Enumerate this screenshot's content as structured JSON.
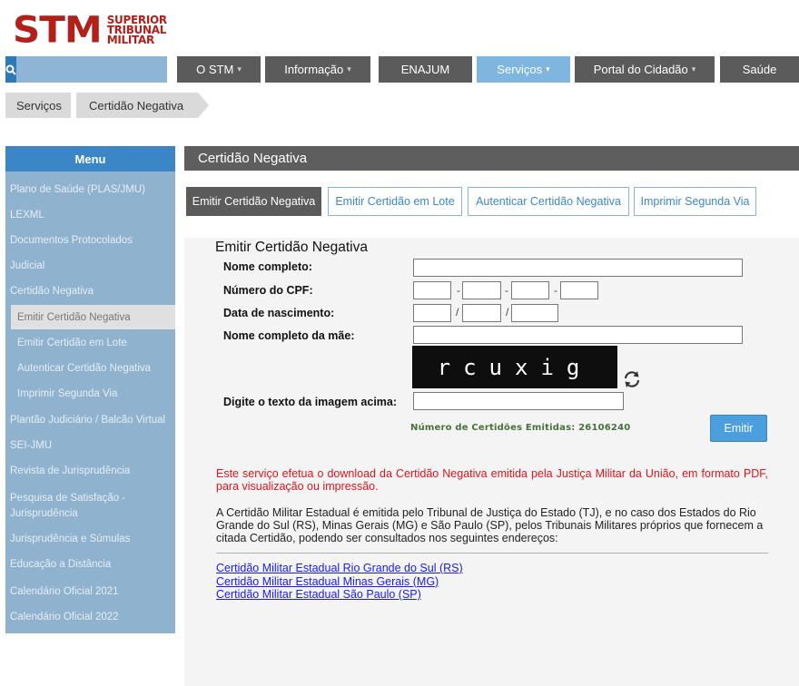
{
  "logo": {
    "main": "STM",
    "line1": "SUPERIOR",
    "line2": "TRIBUNAL",
    "line3": "MILITAR"
  },
  "search": {
    "placeholder": "",
    "icon": "search-icon"
  },
  "nav": [
    {
      "label": "O STM",
      "caret": true,
      "active": false
    },
    {
      "label": "Informação",
      "caret": true,
      "active": false
    },
    {
      "label": "ENAJUM",
      "caret": false,
      "active": false
    },
    {
      "label": "Serviços",
      "caret": true,
      "active": true
    },
    {
      "label": "Portal do Cidadão",
      "caret": true,
      "active": false
    },
    {
      "label": "Saúde",
      "caret": false,
      "active": false
    }
  ],
  "breadcrumb": [
    "Serviços",
    "Certidão Negativa"
  ],
  "sidebar": {
    "title": "Menu",
    "items": [
      {
        "label": "Plano de Saúde (PLAS/JMU)",
        "level": 0
      },
      {
        "label": "LEXML",
        "level": 0
      },
      {
        "label": "Documentos Protocolados",
        "level": 0
      },
      {
        "label": "Judicial",
        "level": 0
      },
      {
        "label": "Certidão Negativa",
        "level": 0
      },
      {
        "label": "Emitir Certidão Negativa",
        "level": 1,
        "selected": true
      },
      {
        "label": "Emitir Certidão em Lote",
        "level": 1
      },
      {
        "label": "Autenticar Certidão Negativa",
        "level": 1
      },
      {
        "label": "Imprimir Segunda Via",
        "level": 1
      },
      {
        "label": "Plantão Judiciário / Balcão Virtual",
        "level": 0
      },
      {
        "label": "SEI-JMU",
        "level": 0
      },
      {
        "label": "Revista de Jurisprudência",
        "level": 0
      },
      {
        "label": "Pesquisa de Satisfação - Jurisprudência",
        "level": 0
      },
      {
        "label": "Jurisprudência e Súmulas",
        "level": 0
      },
      {
        "label": "Educação a Distância",
        "level": 0
      },
      {
        "label": "Calendário Oficial 2021",
        "level": 0
      },
      {
        "label": "Calendário Oficial 2022",
        "level": 0
      }
    ]
  },
  "main": {
    "title": "Certidão Negativa",
    "tabs": [
      {
        "label": "Emitir Certidão Negativa",
        "active": true
      },
      {
        "label": "Emitir Certidão em Lote",
        "active": false
      },
      {
        "label": "Autenticar Certidão Negativa",
        "active": false
      },
      {
        "label": "Imprimir Segunda Via",
        "active": false
      }
    ]
  },
  "form": {
    "title": "Emitir Certidão Negativa",
    "name_label": "Nome completo:",
    "name_value": "",
    "cpf_label": "Número do CPF:",
    "cpf_values": [
      "",
      "",
      "",
      ""
    ],
    "cpf_separators": [
      "-",
      "-",
      "-"
    ],
    "dob_label": "Data de nascimento:",
    "dob_values": [
      "",
      "",
      ""
    ],
    "dob_separators": [
      "/",
      "/"
    ],
    "mother_label": "Nome completo da mãe:",
    "mother_value": "",
    "captcha_text": "rcuxig",
    "captcha_label": "Digite o texto da imagem acima:",
    "captcha_value": "",
    "refresh_icon": "refresh-icon",
    "count_text": "Número de Certidões Emitidas: 26106240",
    "count_value": 26106240,
    "submit_label": "Emitir"
  },
  "notes": {
    "warning": "Este serviço efetua o download da Certidão Negativa emitida pela Justiça Militar da União, em formato PDF, para visualização ou impressão.",
    "info": "A Certidão Militar Estadual é emitida pelo Tribunal de Justiça do Estado (TJ), e no caso dos Estados do Rio Grande do Sul (RS), Minas Gerais (MG) e São Paulo (SP), pelos Tribunais Militares próprios que fornecem a citada Certidão, podendo ser consultados nos seguintes endereços:",
    "links": [
      "Certidão Militar Estadual Rio Grande do Sul (RS)",
      "Certidão Militar Estadual Minas Gerais (MG)",
      "Certidão Militar Estadual São Paulo (SP)"
    ]
  },
  "colors": {
    "brand_red": "#b3201a",
    "nav_gray": "#5b5b5b",
    "nav_active": "#7eb6e0",
    "sidebar_bg": "#8fb2cf",
    "sidebar_head": "#3b86c6",
    "button_blue": "#4a9fdc",
    "warning_red": "#e1131d",
    "link_blue": "#1a1aef",
    "count_green": "#48703c"
  }
}
